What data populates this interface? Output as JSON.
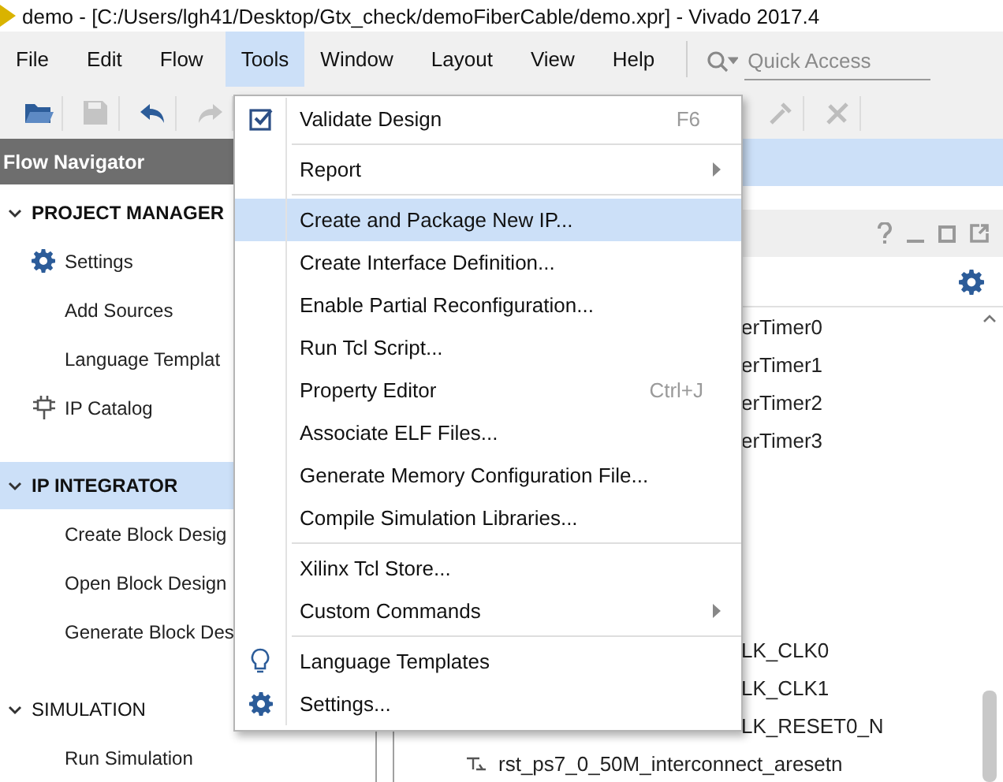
{
  "window": {
    "title": "demo - [C:/Users/lgh41/Desktop/Gtx_check/demoFiberCable/demo.xpr] - Vivado 2017.4"
  },
  "menu_bar": [
    {
      "label": "File",
      "selected": false
    },
    {
      "label": "Edit",
      "selected": false
    },
    {
      "label": "Flow",
      "selected": false
    },
    {
      "label": "Tools",
      "selected": true
    },
    {
      "label": "Window",
      "selected": false
    },
    {
      "label": "Layout",
      "selected": false
    },
    {
      "label": "View",
      "selected": false
    },
    {
      "label": "Help",
      "selected": false
    }
  ],
  "quick_access": {
    "placeholder": "Quick Access"
  },
  "flow_navigator": {
    "title": "Flow Navigator",
    "sections": [
      {
        "title": "PROJECT MANAGER",
        "expanded": true,
        "selected": false,
        "bold": true,
        "items": [
          {
            "label": "Settings"
          },
          {
            "label": "Add Sources"
          },
          {
            "label": "Language Templat"
          },
          {
            "label": "IP Catalog"
          }
        ]
      },
      {
        "title": "IP INTEGRATOR",
        "expanded": true,
        "selected": true,
        "bold": true,
        "items": [
          {
            "label": "Create Block Desig"
          },
          {
            "label": "Open Block Design"
          },
          {
            "label": "Generate Block Des"
          }
        ]
      },
      {
        "title": "SIMULATION",
        "expanded": true,
        "selected": false,
        "bold": false,
        "items": [
          {
            "label": "Run Simulation"
          }
        ]
      }
    ]
  },
  "tools_menu": {
    "items": [
      {
        "kind": "item",
        "label": "Validate Design",
        "shortcut": "F6",
        "selected": false
      },
      {
        "kind": "separator"
      },
      {
        "kind": "item",
        "label": "Report",
        "submenu": true,
        "selected": false
      },
      {
        "kind": "separator"
      },
      {
        "kind": "item",
        "label": "Create and Package New IP...",
        "selected": true
      },
      {
        "kind": "item",
        "label": "Create Interface Definition...",
        "selected": false
      },
      {
        "kind": "item",
        "label": "Enable Partial Reconfiguration...",
        "selected": false
      },
      {
        "kind": "item",
        "label": "Run Tcl Script...",
        "selected": false
      },
      {
        "kind": "item",
        "label": "Property Editor",
        "shortcut": "Ctrl+J",
        "selected": false
      },
      {
        "kind": "item",
        "label": "Associate ELF Files...",
        "selected": false
      },
      {
        "kind": "item",
        "label": "Generate Memory Configuration File...",
        "selected": false
      },
      {
        "kind": "item",
        "label": "Compile Simulation Libraries...",
        "selected": false
      },
      {
        "kind": "separator"
      },
      {
        "kind": "item",
        "label": "Xilinx Tcl Store...",
        "selected": false
      },
      {
        "kind": "item",
        "label": "Custom Commands",
        "submenu": true,
        "selected": false
      },
      {
        "kind": "separator"
      },
      {
        "kind": "item",
        "label": "Language Templates",
        "selected": false
      },
      {
        "kind": "item",
        "label": "Settings...",
        "selected": false
      }
    ]
  },
  "design_panel": {
    "rows_upper": [
      {
        "kind": "partial",
        "label": "erTimer0"
      },
      {
        "kind": "partial",
        "label": "erTimer1"
      },
      {
        "kind": "partial",
        "label": "erTimer2"
      },
      {
        "kind": "partial",
        "label": "erTimer3"
      }
    ],
    "rows_lower": [
      {
        "kind": "partial",
        "label": "LK_CLK0"
      },
      {
        "kind": "partial",
        "label": "LK_CLK1"
      },
      {
        "kind": "partial",
        "label": "LK_RESET0_N"
      },
      {
        "kind": "net",
        "label": "rst_ps7_0_50M_interconnect_aresetn"
      }
    ]
  }
}
